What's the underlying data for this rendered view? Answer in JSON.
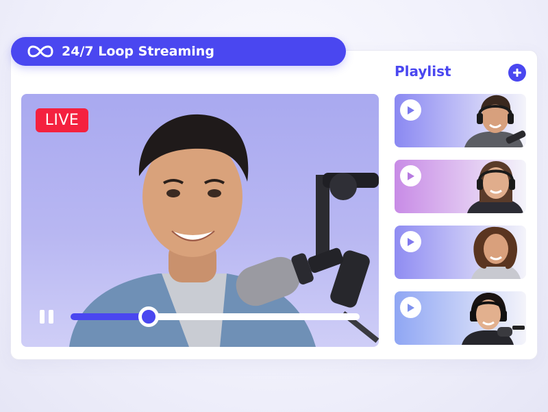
{
  "banner": {
    "title": "24/7 Loop Streaming",
    "icon": "infinity-icon"
  },
  "video": {
    "badge": "LIVE",
    "progress": 0.27
  },
  "playlist": {
    "title": "Playlist",
    "items": [
      {
        "gradient": [
          "#8a88f2",
          "#f4f4fa"
        ]
      },
      {
        "gradient": [
          "#c88be6",
          "#f4f4fa"
        ]
      },
      {
        "gradient": [
          "#8f8cf2",
          "#f4f4fa"
        ]
      },
      {
        "gradient": [
          "#8fa6f4",
          "#f4f4fa"
        ]
      }
    ]
  },
  "colors": {
    "accent": "#4a47f0",
    "live": "#f4213f"
  }
}
